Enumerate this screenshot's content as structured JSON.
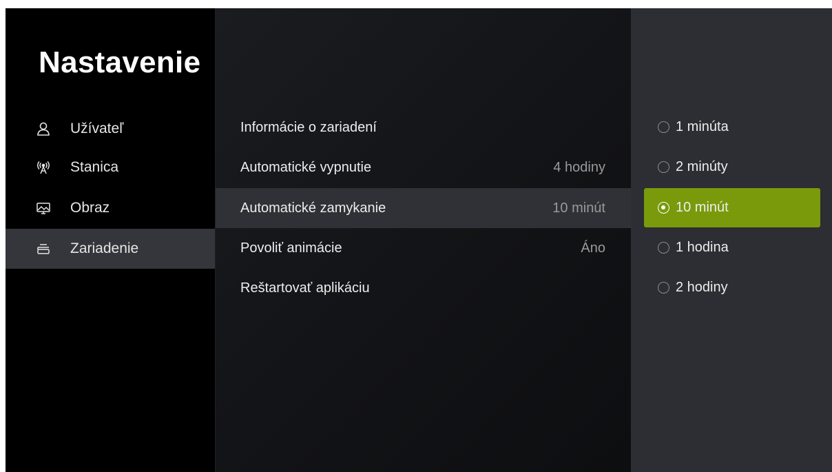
{
  "nav": {
    "title": "Nastavenie",
    "items": [
      {
        "label": "Užívateľ",
        "icon": "user-icon"
      },
      {
        "label": "Stanica",
        "icon": "antenna-icon"
      },
      {
        "label": "Obraz",
        "icon": "picture-icon"
      },
      {
        "label": "Zariadenie",
        "icon": "device-icon",
        "active": true
      }
    ]
  },
  "settings": {
    "rows": [
      {
        "label": "Informácie o zariadení",
        "value": ""
      },
      {
        "label": "Automatické vypnutie",
        "value": "4 hodiny"
      },
      {
        "label": "Automatické zamykanie",
        "value": "10 minút",
        "active": true
      },
      {
        "label": "Povoliť animácie",
        "value": "Áno"
      },
      {
        "label": "Reštartovať aplikáciu",
        "value": ""
      }
    ]
  },
  "options": {
    "items": [
      {
        "label": "1 minúta"
      },
      {
        "label": "2 minúty"
      },
      {
        "label": "10 minút",
        "selected": true
      },
      {
        "label": "1 hodina"
      },
      {
        "label": "2 hodiny"
      }
    ]
  },
  "colors": {
    "accent": "#7a9a0c",
    "nav_active_bg": "#34363b",
    "row_active_bg": "#2f3136",
    "right_panel_bg": "#2c2e33"
  }
}
